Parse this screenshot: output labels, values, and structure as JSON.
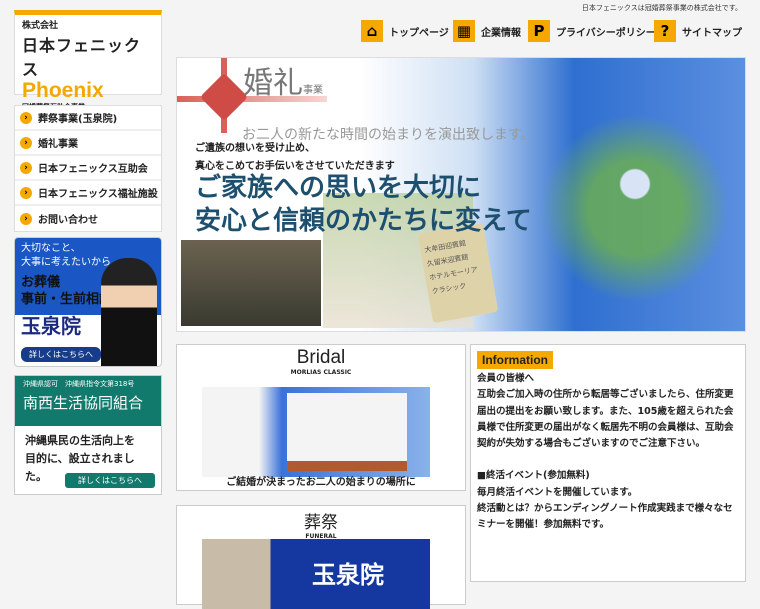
{
  "header": {
    "tagline": "日本フェニックスは冠婚葬祭事業の株式会社です。",
    "logo": {
      "company": "株式会社",
      "name_jp": "日本フェニックス",
      "name_en": "Phoenix",
      "subtitle": "冠婚葬祭互助会事業"
    },
    "nav": [
      {
        "label": "トップページ",
        "icon": "home-icon"
      },
      {
        "label": "企業情報",
        "icon": "building-icon"
      },
      {
        "label": "プライバシーポリシー",
        "icon": "parking-p-icon"
      },
      {
        "label": "サイトマップ",
        "icon": "question-icon"
      }
    ]
  },
  "sidebar": {
    "menu": [
      "葬祭事業(玉泉院)",
      "婚礼事業",
      "日本フェニックス互助会",
      "日本フェニックス福祉施設",
      "お問い合わせ"
    ],
    "banner1": {
      "line1": "大切なこと、",
      "line2": "大事に考えたいから…",
      "line3": "お葬儀",
      "line4": "事前・生前相談",
      "brand": "玉泉院",
      "button": "詳しくはこちらへ"
    },
    "banner2": {
      "small": "沖縄県認可　沖縄県指令文第318号",
      "title": "南西生活協同組合",
      "body1": "沖縄県民の生活向上を",
      "body2": "目的に、設立されました。",
      "button": "詳しくはこちらへ"
    }
  },
  "hero": {
    "title": "婚礼",
    "title_small": "事業",
    "slogan": "お二人の新たな時間の始まりを演出致します。",
    "line1": "ご遺族の想いを受け止め、",
    "line2": "真心をこめてお手伝いをさせていただきます",
    "big1": "ご家族への思いを大切に",
    "big2": "安心と信頼のかたちに変えて",
    "tag": [
      "大牟田迎賓館",
      "久留米迎賓館",
      "ホテルモーリア",
      "クラシック"
    ]
  },
  "bridal": {
    "title": "Bridal",
    "subtitle": "MORLIAS CLASSIC",
    "caption": "ご結婚が決まったお二人の始まりの場所に"
  },
  "funeral": {
    "title": "葬祭",
    "subtitle": "FUNERAL",
    "brand": "玉泉院"
  },
  "info": {
    "heading": "Information",
    "paragraphs": [
      "会員の皆様へ",
      "互助会ご加入時の住所から転居等ございましたら、住所変更届出の提出をお願い致します。また、105歳を超えられた会員様で住所変更の届出がなく転居先不明の会員様は、互助会契約が失効する場合もございますのでご注意下さい。",
      "■終活イベント(参加無料)",
      "毎月終活イベントを開催しています。",
      "終活動とは？からエンディングノート作成実践まで様々なセミナーを開催！参加無料です。"
    ]
  }
}
